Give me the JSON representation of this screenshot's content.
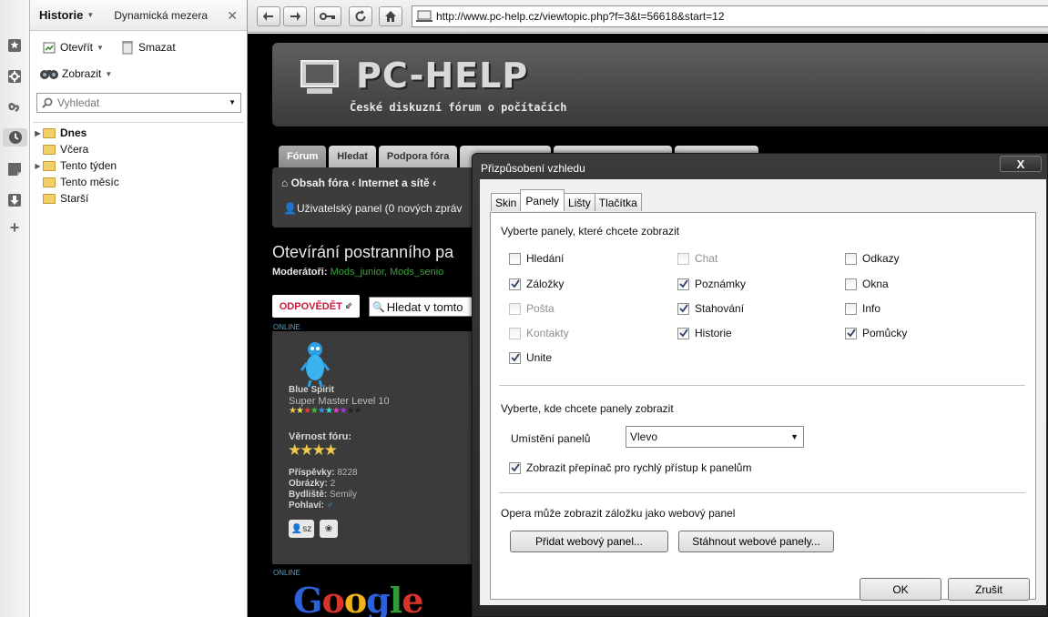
{
  "panel": {
    "title": "Historie",
    "secondary_tab": "Dynamická mezera",
    "open_label": "Otevřít",
    "delete_label": "Smazat",
    "view_label": "Zobrazit",
    "search_placeholder": "Vyhledat",
    "tree": [
      {
        "label": "Dnes",
        "expandable": true,
        "bold": true
      },
      {
        "label": "Včera",
        "expandable": false,
        "bold": false
      },
      {
        "label": "Tento týden",
        "expandable": true,
        "bold": false
      },
      {
        "label": "Tento měsíc",
        "expandable": false,
        "bold": false
      },
      {
        "label": "Starší",
        "expandable": false,
        "bold": false
      }
    ]
  },
  "browser": {
    "url": "http://www.pc-help.cz/viewtopic.php?f=3&t=56618&start=12"
  },
  "web": {
    "logo": "PC-HELP",
    "tagline": "České diskuzní fórum o počítačích",
    "nav_tabs": [
      "Fórum",
      "Hledat",
      "Podpora fóra",
      "",
      "",
      ""
    ],
    "breadcrumb": "Obsah fóra ‹ Internet a sítě ‹",
    "user_panel": "Uživatelský panel (0 nových zpráv",
    "topic_title": "Otevírání postranního pa",
    "moderators_label": "Moderátoři:",
    "moderators": "Mods_junior, Mods_senio",
    "reply_label": "ODPOVĚDĚT",
    "search_topic_label": "Hledat v tomto",
    "online": "ONLINE",
    "post": {
      "user": "Blue Spirit",
      "rank": "Super Master Level 10",
      "loyalty_label": "Věrnost fóru:",
      "posts_label": "Příspěvky:",
      "posts": "8228",
      "images_label": "Obrázky:",
      "images": "2",
      "location_label": "Bydliště:",
      "location": "Semily",
      "gender_label": "Pohlaví:",
      "pm_label": "sz"
    },
    "google": "Google"
  },
  "dialog": {
    "title": "Přizpůsobení vzhledu",
    "close": "X",
    "tabs": [
      {
        "label": "Skin",
        "active": false
      },
      {
        "label": "Panely",
        "active": true
      },
      {
        "label": "Lišty",
        "active": false
      },
      {
        "label": "Tlačítka",
        "active": false
      }
    ],
    "choose_panels": "Vyberte panely, které chcete zobrazit",
    "panels": [
      {
        "label": "Hledání",
        "checked": false,
        "enabled": true
      },
      {
        "label": "Záložky",
        "checked": true,
        "enabled": true
      },
      {
        "label": "Pošta",
        "checked": false,
        "enabled": false
      },
      {
        "label": "Kontakty",
        "checked": false,
        "enabled": false
      },
      {
        "label": "Unite",
        "checked": true,
        "enabled": true
      },
      {
        "label": "Chat",
        "checked": false,
        "enabled": false
      },
      {
        "label": "Poznámky",
        "checked": true,
        "enabled": true
      },
      {
        "label": "Stahování",
        "checked": true,
        "enabled": true
      },
      {
        "label": "Historie",
        "checked": true,
        "enabled": true
      },
      {
        "label": "Odkazy",
        "checked": false,
        "enabled": true
      },
      {
        "label": "Okna",
        "checked": false,
        "enabled": true
      },
      {
        "label": "Info",
        "checked": false,
        "enabled": true
      },
      {
        "label": "Pomůcky",
        "checked": true,
        "enabled": true
      }
    ],
    "choose_location": "Vyberte, kde chcete panely zobrazit",
    "position_label": "Umístění panelů",
    "position_value": "Vlevo",
    "quick_switch_label": "Zobrazit přepínač pro rychlý přístup k panelům",
    "quick_switch_checked": true,
    "web_panel_text": "Opera může zobrazit záložku jako webový panel",
    "add_web_panel": "Přidat webový panel...",
    "download_web_panels": "Stáhnout webové panely...",
    "ok": "OK",
    "cancel": "Zrušit"
  }
}
